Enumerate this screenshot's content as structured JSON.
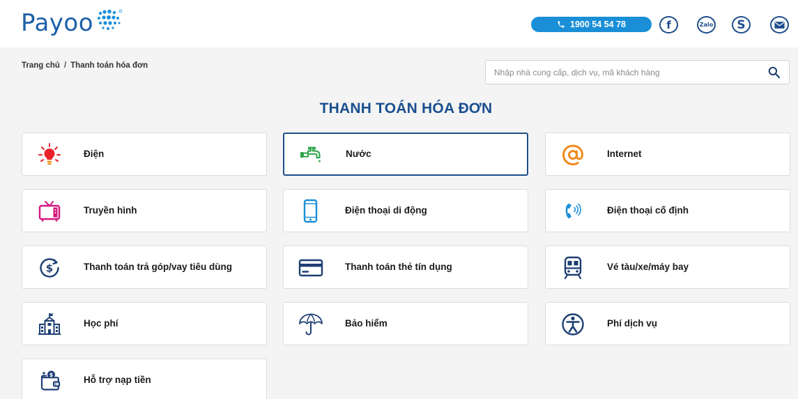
{
  "header": {
    "logo_text": "Payoo",
    "hotline": "1900 54 54 78",
    "social": [
      "f",
      "Zalo",
      "S"
    ]
  },
  "breadcrumb": {
    "home": "Trang chủ",
    "separator": "/",
    "current": "Thanh toán hóa đơn"
  },
  "search": {
    "placeholder": "Nhập nhà cung cấp, dịch vụ, mã khách hàng"
  },
  "page_title": "THANH TOÁN HÓA ĐƠN",
  "services": [
    {
      "label": "Điện",
      "icon": "lightbulb-icon"
    },
    {
      "label": "Nước",
      "icon": "water-tap-icon"
    },
    {
      "label": "Internet",
      "icon": "at-sign-icon"
    },
    {
      "label": "Truyền hình",
      "icon": "tv-icon"
    },
    {
      "label": "Điện thoại di động",
      "icon": "mobile-phone-icon"
    },
    {
      "label": "Điện thoại cố định",
      "icon": "landline-phone-icon"
    },
    {
      "label": "Thanh toán trả góp/vay tiêu dùng",
      "icon": "installment-dollar-icon"
    },
    {
      "label": "Thanh toán thẻ tín dụng",
      "icon": "credit-card-icon"
    },
    {
      "label": "Vé tàu/xe/máy bay",
      "icon": "train-icon"
    },
    {
      "label": "Học phí",
      "icon": "school-icon"
    },
    {
      "label": "Bảo hiểm",
      "icon": "umbrella-icon"
    },
    {
      "label": "Phí dịch vụ",
      "icon": "service-person-icon"
    },
    {
      "label": "Hỗ trợ nạp tiền",
      "icon": "wallet-topup-icon"
    }
  ],
  "colors": {
    "brand_blue": "#1b4f8f",
    "hotline_bg": "#1a8fd8",
    "electric_red": "#e8212a",
    "water_green": "#2aa34a",
    "internet_orange": "#f08a1d",
    "tv_magenta": "#d4177d",
    "phone_blue": "#1a8fd8",
    "icon_navy": "#1e3f73"
  }
}
